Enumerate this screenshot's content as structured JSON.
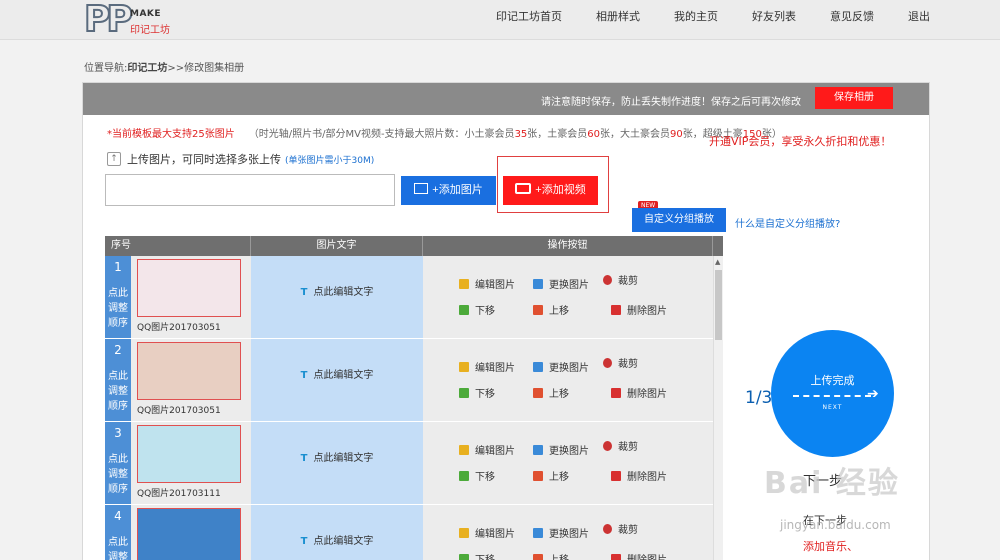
{
  "logo": {
    "mark": "PP",
    "make": "MAKE",
    "sub": "印记工坊"
  },
  "nav": [
    "印记工坊首页",
    "相册样式",
    "我的主页",
    "好友列表",
    "意见反馈",
    "退出"
  ],
  "breadcrumb": {
    "prefix": "位置导航:",
    "home": "印记工坊",
    "current": ">>修改图集相册"
  },
  "panel": {
    "notice": "请注意随时保存，防止丢失制作进度！保存之后可再次修改",
    "save_label": "保存相册",
    "limit_red": "*当前模板最大支持25张图片",
    "limit_gray_pre": "（时光轴/照片书/部分MV视频-支持最大照片数：小土豪会员",
    "limit_n1": "35",
    "limit_gray_mid1": "张，土豪会员",
    "limit_n2": "60",
    "limit_gray_mid2": "张，大土豪会员",
    "limit_n3": "90",
    "limit_gray_end": "张，超级土豪",
    "limit_n4": "150",
    "limit_gray_tail": "张）",
    "vip_text": "开通VIP会员，享受永久折扣和优惠！",
    "upload_icon": "up-arrow-icon",
    "upload_label": "上传图片，可同时选择多张上传",
    "upload_hint": "(单张图片需小于30M)",
    "url_input_value": "",
    "add_picture_label": "+添加图片",
    "add_video_label": "+添加视频",
    "new_badge": "NEW",
    "custom_group_label": "自定义分组播放",
    "custom_group_help": "什么是自定义分组播放?"
  },
  "table": {
    "headers": [
      "序号",
      "图片文字",
      "操作按钮"
    ],
    "adjust_label": [
      "点此",
      "调整",
      "顺序"
    ],
    "edit_text_label": "点此编辑文字",
    "ops": {
      "edit": "编辑图片",
      "replace": "更换图片",
      "crop": "裁剪",
      "down": "下移",
      "up": "上移",
      "delete": "删除图片"
    },
    "rows": [
      {
        "index": "1",
        "filename": "QQ图片201703051"
      },
      {
        "index": "2",
        "filename": "QQ图片201703051"
      },
      {
        "index": "3",
        "filename": "QQ图片201703111"
      },
      {
        "index": "4",
        "filename": ""
      }
    ]
  },
  "progress": {
    "step": "1/3",
    "done_label": "上传完成",
    "next_tag": "NEXT",
    "next_step": "下一步",
    "next_sub": "在下一步",
    "music_label": "添加音乐、"
  },
  "watermark": {
    "brand": "Bai 经验",
    "url": "jingyan.baidu.com"
  },
  "colors": {
    "accent_blue": "#1a6fe0",
    "accent_red": "#ff1a1a",
    "circle_blue": "#0b84f2"
  }
}
